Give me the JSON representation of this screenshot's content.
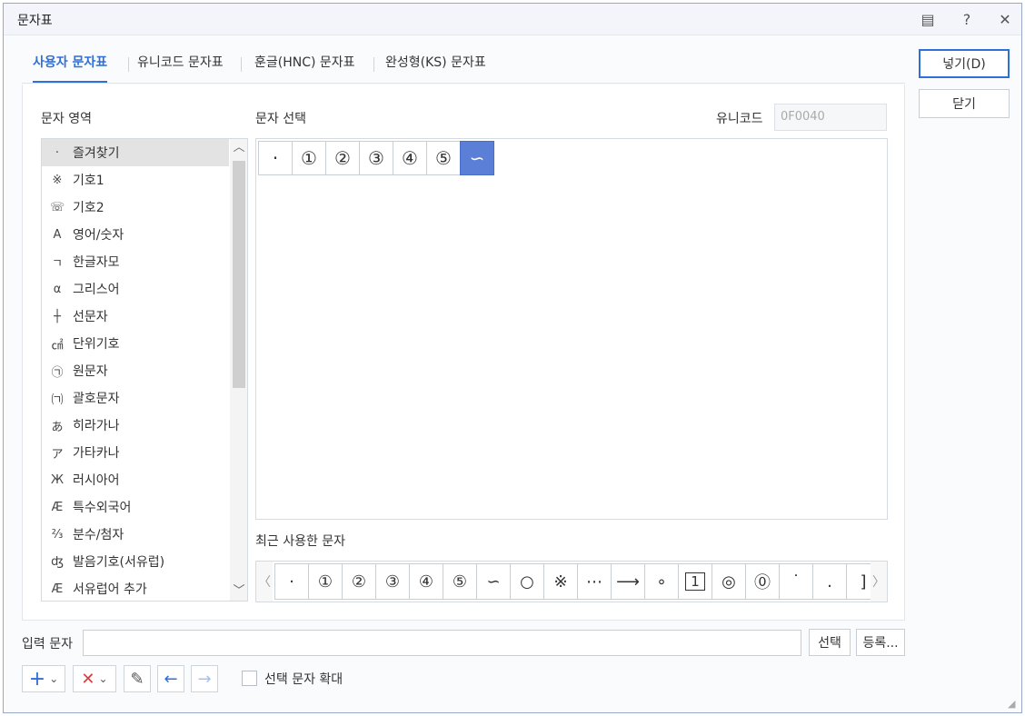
{
  "window": {
    "title": "문자표"
  },
  "titlebar_icons": [
    "comment-icon",
    "help-icon",
    "close-icon"
  ],
  "titlebar_glyphs": {
    "comment": "▤",
    "help": "?",
    "close": "✕"
  },
  "tabs": [
    {
      "label": "사용자 문자표",
      "active": true
    },
    {
      "label": "유니코드 문자표",
      "active": false
    },
    {
      "label": "훈글(HNC) 문자표",
      "active": false
    },
    {
      "label": "완성형(KS) 문자표",
      "active": false
    }
  ],
  "labels": {
    "char_area": "문자 영역",
    "char_select": "문자 선택",
    "unicode": "유니코드",
    "recent": "최근 사용한 문자",
    "input": "입력 문자",
    "enlarge": "선택 문자 확대"
  },
  "unicode_value": "0F0040",
  "categories": [
    {
      "symbol": "·",
      "name": "즐겨찾기"
    },
    {
      "symbol": "※",
      "name": "기호1"
    },
    {
      "symbol": "☏",
      "name": "기호2"
    },
    {
      "symbol": "A",
      "name": "영어/숫자"
    },
    {
      "symbol": "ㄱ",
      "name": "한글자모"
    },
    {
      "symbol": "α",
      "name": "그리스어"
    },
    {
      "symbol": "┼",
      "name": "선문자"
    },
    {
      "symbol": "㎠",
      "name": "단위기호"
    },
    {
      "symbol": "㉠",
      "name": "원문자"
    },
    {
      "symbol": "㈀",
      "name": "괄호문자"
    },
    {
      "symbol": "あ",
      "name": "히라가나"
    },
    {
      "symbol": "ア",
      "name": "가타카나"
    },
    {
      "symbol": "Ж",
      "name": "러시아어"
    },
    {
      "symbol": "Æ",
      "name": "특수외국어"
    },
    {
      "symbol": "⅔",
      "name": "분수/첨자"
    },
    {
      "symbol": "ʤ",
      "name": "발음기호(서유럽)"
    },
    {
      "symbol": "Æ",
      "name": "서유럽어 추가"
    }
  ],
  "scroll_glyphs": {
    "up": "︿",
    "down": "﹀"
  },
  "selected_category": "즐겨찾기",
  "chars": [
    "·",
    "①",
    "②",
    "③",
    "④",
    "⑤",
    "∽"
  ],
  "selected_char": "∽",
  "recent_nav": {
    "prev": "〈",
    "next": "〉"
  },
  "recent": [
    "·",
    "①",
    "②",
    "③",
    "④",
    "⑤",
    "∽",
    "○",
    "※",
    "⋯",
    "⟶",
    "∘",
    "1",
    "◎",
    "⓪",
    "˙",
    ".",
    "]"
  ],
  "buttons": {
    "insert": "넣기(D)",
    "close": "닫기",
    "select": "선택",
    "register": "등록..."
  },
  "tool_glyphs": {
    "add": "+",
    "delete": "✕",
    "edit": "✎",
    "back": "←",
    "forward": "→",
    "dropdown": "⌄"
  },
  "colors": {
    "accent": "#2f6fd8",
    "selected_char_bg": "#5b7fd6",
    "delete_red": "#e03a3a"
  }
}
